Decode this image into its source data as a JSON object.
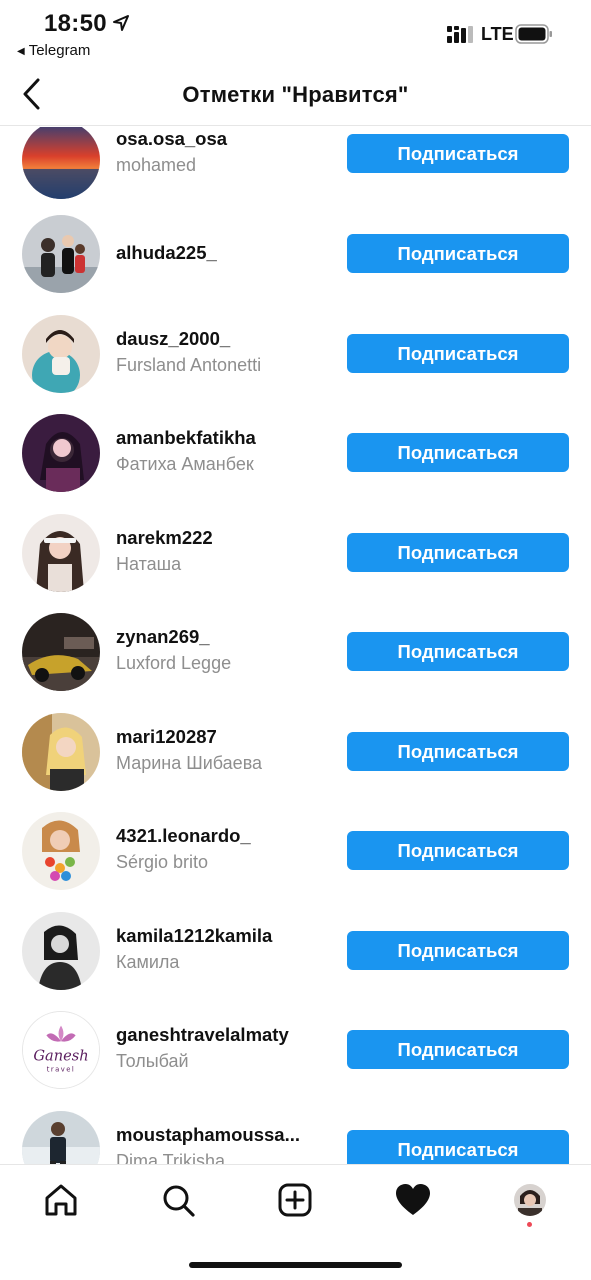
{
  "status_bar": {
    "time": "18:50",
    "back_app": "Telegram",
    "network": "LTE",
    "icons": [
      "location-arrow-icon",
      "signal-icon",
      "battery-icon"
    ]
  },
  "header": {
    "title": "Отметки \"Нравится\"",
    "back_icon": "chevron-left-icon"
  },
  "likes": [
    {
      "username": "osa.osa_osa",
      "full_name": "mohamed",
      "button": "Подписаться"
    },
    {
      "username": "alhuda225_",
      "full_name": "",
      "button": "Подписаться"
    },
    {
      "username": "dausz_2000_",
      "full_name": "Fursland Antonetti",
      "button": "Подписаться"
    },
    {
      "username": "amanbekfatikha",
      "full_name": "Фатиха Аманбек",
      "button": "Подписаться"
    },
    {
      "username": "narekm222",
      "full_name": "Наташа",
      "button": "Подписаться"
    },
    {
      "username": "zynan269_",
      "full_name": "Luxford Legge",
      "button": "Подписаться"
    },
    {
      "username": "mari120287",
      "full_name": "Марина Шибаева",
      "button": "Подписаться"
    },
    {
      "username": "4321.leonardo_",
      "full_name": "Sérgio brito",
      "button": "Подписаться"
    },
    {
      "username": "kamila1212kamila",
      "full_name": "Камила",
      "button": "Подписаться"
    },
    {
      "username": "ganeshtravelalmaty",
      "full_name": "Толыбай",
      "button": "Подписаться",
      "avatar_logo": {
        "brand": "Ganesh",
        "sub": "travel"
      }
    },
    {
      "username": "moustaphamoussa...",
      "full_name": "Dima Trikisha",
      "button": "Подписаться"
    }
  ],
  "tab_bar": {
    "tabs": [
      "home-icon",
      "search-icon",
      "new-post-icon",
      "activity-heart-icon",
      "profile-avatar"
    ]
  },
  "colors": {
    "accent": "#1a95f0",
    "secondary_text": "#8e8e8e",
    "notification_dot": "#ed4956"
  }
}
